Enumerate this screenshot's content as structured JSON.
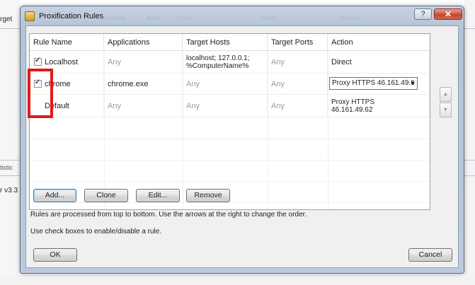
{
  "background": {
    "left_fragments": [
      "rget",
      "tistic",
      "r v3.3"
    ]
  },
  "window": {
    "title": "Proxification Rules",
    "ghost_tabs": [
      "Gateway",
      "Base",
      "Proxy",
      "Speed",
      "Process"
    ],
    "help_label": "?",
    "close_label": "✕"
  },
  "rules": {
    "columns": [
      "Rule Name",
      "Applications",
      "Target Hosts",
      "Target Ports",
      "Action"
    ],
    "rows": [
      {
        "name": "Localhost",
        "checked": true,
        "applications": "Any",
        "hosts_line1": "localhost; 127.0.0.1;",
        "hosts_line2": "%ComputerName%",
        "ports": "Any",
        "action": "Direct"
      },
      {
        "name": "chrome",
        "checked": true,
        "applications": "chrome.exe",
        "hosts_line1": "Any",
        "ports": "Any",
        "action": "Proxy HTTPS 46.161.49.6"
      },
      {
        "name": "Default",
        "applications": "Any",
        "hosts_line1": "Any",
        "ports": "Any",
        "action_line1": "Proxy HTTPS",
        "action_line2": "46.161.49.62"
      }
    ]
  },
  "scroll": {
    "up_icon": "▲",
    "down_icon": "▼"
  },
  "buttons": {
    "add": "Add...",
    "clone": "Clone",
    "edit": "Edit...",
    "remove": "Remove",
    "ok": "OK",
    "cancel": "Cancel"
  },
  "info": {
    "line1": "Rules are processed from top to bottom. Use the arrows at the right to change the order.",
    "line2": "Use check boxes to enable/disable a rule."
  },
  "colors": {
    "highlight": "#e01b1b",
    "close": "#c8452f",
    "frame": "#b4c4d6"
  }
}
